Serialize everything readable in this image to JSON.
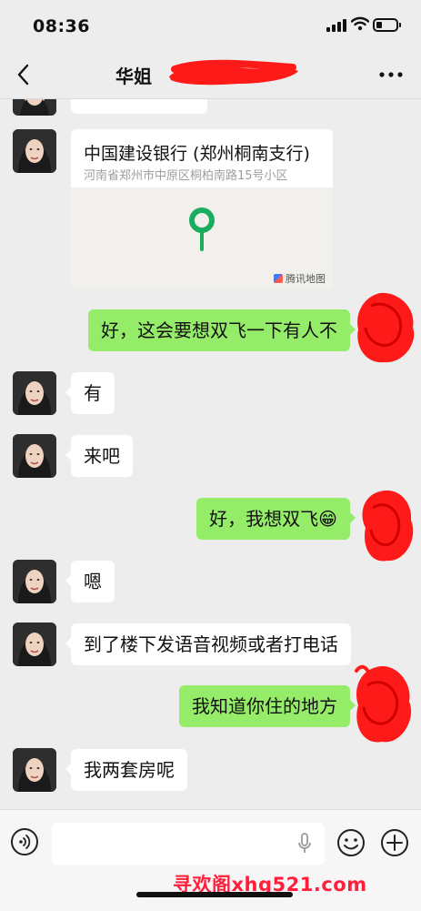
{
  "status_bar": {
    "time": "08:36",
    "battery_level": 0.3
  },
  "nav": {
    "title": "华姐",
    "back_icon": "chevron-left-icon",
    "more_icon": "more-dots-icon"
  },
  "location": {
    "name": "中国建设银行 (郑州桐南支行)",
    "address": "河南省郑州市中原区桐柏南路15号小区",
    "map_brand": "腾讯地图"
  },
  "messages": [
    {
      "from": "me",
      "text": "好，这会要想双飞一下有人不"
    },
    {
      "from": "contact",
      "text": "有"
    },
    {
      "from": "contact",
      "text": "来吧"
    },
    {
      "from": "me",
      "text": "好，我想双飞😁"
    },
    {
      "from": "contact",
      "text": "嗯"
    },
    {
      "from": "contact",
      "text": "到了楼下发语音视频或者打电话"
    },
    {
      "from": "me",
      "text": "我知道你住的地方"
    },
    {
      "from": "contact",
      "text": "我两套房呢"
    }
  ],
  "input_bar": {
    "voice_icon": "voice-mode-icon",
    "mic_icon": "microphone-icon",
    "emoji_icon": "emoji-icon",
    "plus_icon": "plus-icon"
  },
  "watermark": "寻欢阁xhg521.com",
  "colors": {
    "background": "#ededed",
    "outgoing_bubble": "#95ec69",
    "incoming_bubble": "#ffffff",
    "redaction": "#ff1a1a",
    "pin": "#1aad5f"
  }
}
